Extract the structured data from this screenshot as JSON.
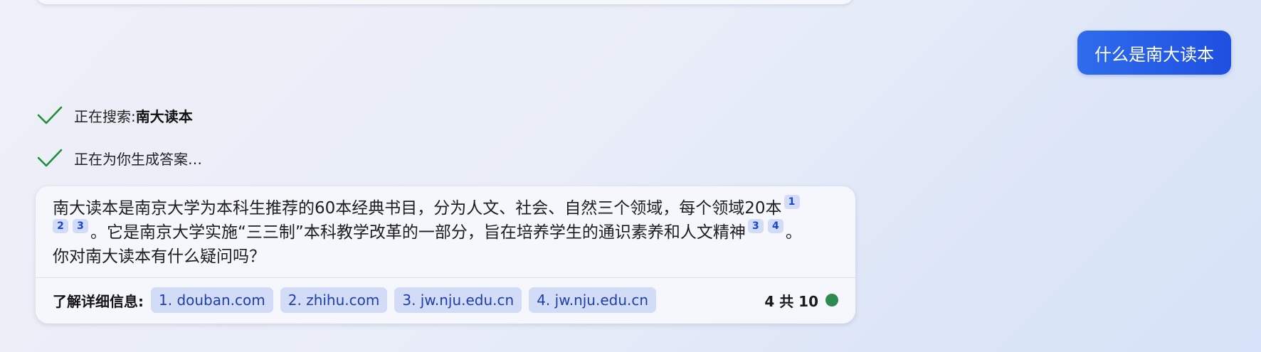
{
  "user_message": "什么是南大读本",
  "status": [
    {
      "prefix": "正在搜索: ",
      "bold": "南大读本",
      "icon": "checkmark-icon"
    },
    {
      "prefix": "正在为你生成答案…",
      "bold": "",
      "icon": "checkmark-icon"
    }
  ],
  "answer": {
    "p1": "南大读本是南京大学为本科生推荐的60本经典书目，分为人文、社会、自然三个领域，每个领域20本",
    "c1": "1",
    "c2": "2",
    "c3": "3",
    "p2": "。它是南京大学实施“三三制”本科教学改革的一部分，旨在培养学生的通识素养和人文精神",
    "c4": "3",
    "c5": "4",
    "p3": "。",
    "p4": "你对南大读本有什么疑问吗？"
  },
  "learn_more": {
    "label": "了解详细信息:",
    "sources": [
      "1. douban.com",
      "2. zhihu.com",
      "3. jw.nju.edu.cn",
      "4. jw.nju.edu.cn"
    ]
  },
  "turn_counter": "4 共 10",
  "colors": {
    "accent": "#1f4fe0",
    "check": "#1e8e3e",
    "status_dot": "#2e8b4f",
    "citation_bg": "#d3dcf6"
  }
}
